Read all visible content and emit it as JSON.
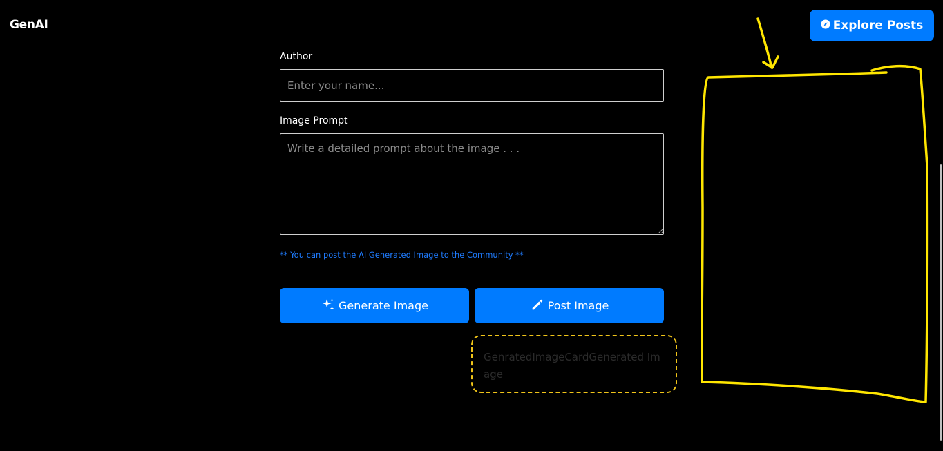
{
  "header": {
    "logo": "GenAI",
    "explore_label": "Explore Posts"
  },
  "form": {
    "author_label": "Author",
    "author_placeholder": "Enter your name...",
    "prompt_label": "Image Prompt",
    "prompt_placeholder": "Write a detailed prompt about the image . . .",
    "hint": "** You can post the AI Generated Image to the Community **"
  },
  "buttons": {
    "generate_label": "Generate Image",
    "post_label": "Post Image"
  },
  "card": {
    "text": "GenratedImageCardGenerated Image"
  },
  "colors": {
    "accent": "#007bff",
    "hint": "#1f7cff",
    "annotation": "#ffe600",
    "card_border": "#f0c419",
    "background": "#000000"
  },
  "icons": {
    "explore": "compass-icon",
    "generate": "sparkles-icon",
    "post": "pencil-icon"
  }
}
